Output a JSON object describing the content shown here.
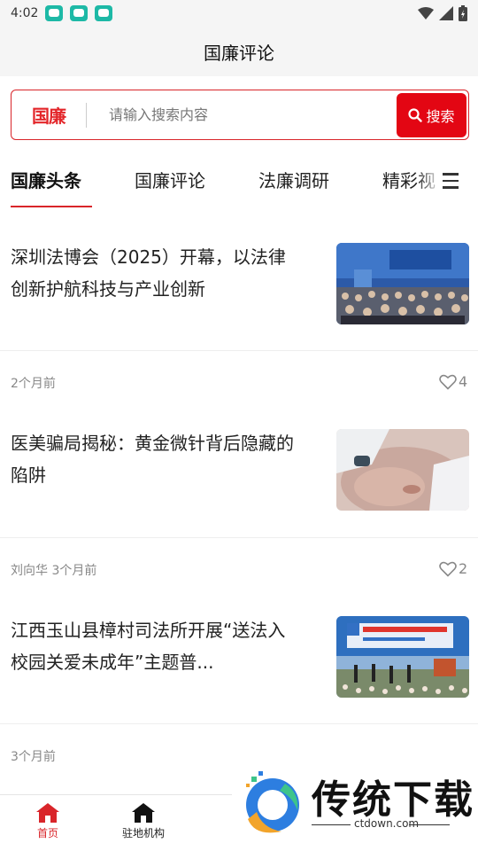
{
  "status_bar": {
    "time": "4:02"
  },
  "header": {
    "title": "国廉评论"
  },
  "search": {
    "logo": "国廉",
    "placeholder": "请输入搜索内容",
    "button_label": "搜索"
  },
  "tabs": [
    {
      "label": "国廉头条",
      "active": true
    },
    {
      "label": "国廉评论",
      "active": false
    },
    {
      "label": "法廉调研",
      "active": false
    },
    {
      "label": "精彩视",
      "active": false
    }
  ],
  "articles": [
    {
      "title": "深圳法博会（2025）开幕，以法律创新护航科技与产业创新",
      "meta": "2个月前",
      "likes": "4"
    },
    {
      "title": "医美骗局揭秘：黄金微针背后隐藏的陷阱",
      "meta": "刘向华 3个月前",
      "likes": "2"
    },
    {
      "title": "江西玉山县樟村司法所开展“送法入校园关爱未成年”主题普...",
      "meta": "3个月前",
      "likes": ""
    }
  ],
  "bottom_nav": [
    {
      "label": "首页",
      "icon": "home-icon",
      "active": true
    },
    {
      "label": "驻地机构",
      "icon": "building-icon",
      "active": false
    }
  ],
  "watermark": {
    "name": "传统下载",
    "url": "ctdown.com"
  },
  "colors": {
    "accent": "#d9252a",
    "search_button": "#e30613"
  }
}
